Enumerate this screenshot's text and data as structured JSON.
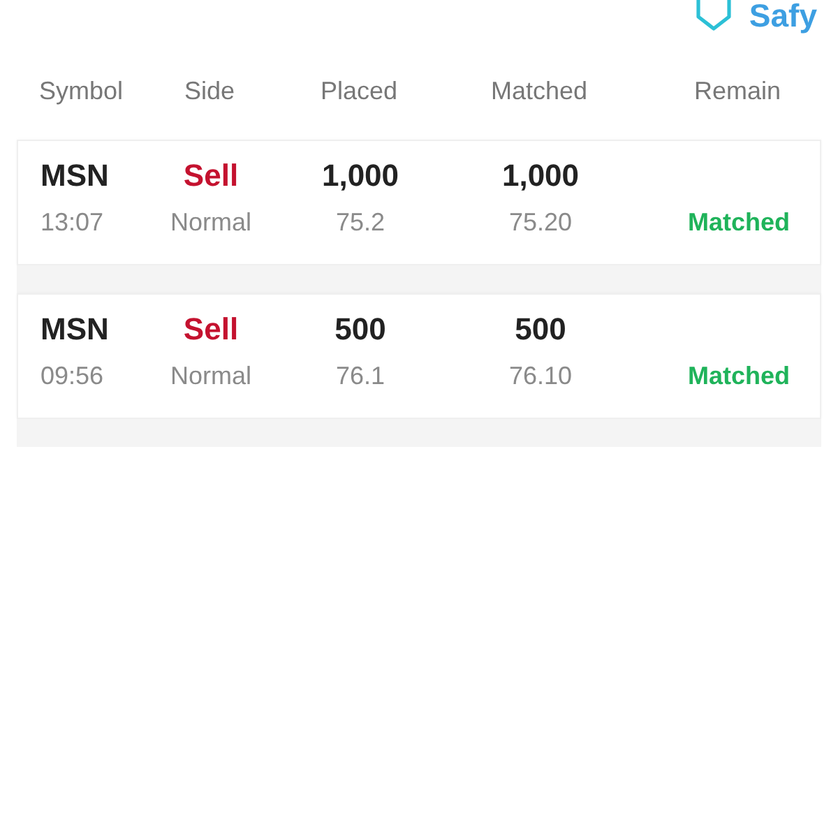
{
  "logo": {
    "text": "Safy"
  },
  "table": {
    "columns": [
      "Symbol",
      "Side",
      "Placed",
      "Matched",
      "Remain"
    ],
    "rows": [
      {
        "symbol": "MSN",
        "time": "13:07",
        "side": {
          "text": "Sell",
          "kind": "sell"
        },
        "order_type": "Normal",
        "placed_qty": "1,000",
        "placed_price": "75.2",
        "matched_qty": "1,000",
        "matched_price": "75.20",
        "status": {
          "text": "Matched",
          "kind": "matched"
        }
      },
      {
        "symbol": "MSN",
        "time": "09:56",
        "side": {
          "text": "Sell",
          "kind": "sell"
        },
        "order_type": "Normal",
        "placed_qty": "500",
        "placed_price": "76.1",
        "matched_qty": "500",
        "matched_price": "76.10",
        "status": {
          "text": "Matched",
          "kind": "matched"
        }
      }
    ]
  }
}
